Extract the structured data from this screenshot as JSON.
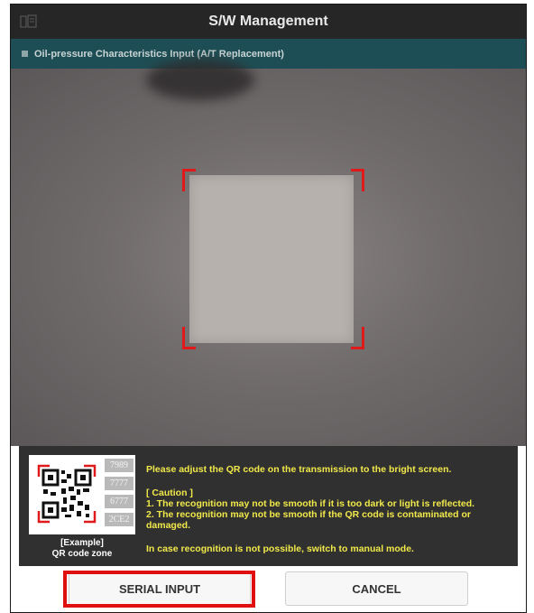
{
  "header": {
    "title": "S/W Management",
    "app_icon": "document-icon"
  },
  "subheader": {
    "title": "Oil-pressure Characteristics Input (A/T Replacement)"
  },
  "example": {
    "codes": [
      "7989",
      "7777",
      "6777",
      "2CE2"
    ],
    "caption_line1": "[Example]",
    "caption_line2": "QR code zone"
  },
  "messages": {
    "instruction": "Please adjust the QR code on the transmission to the bright screen.",
    "caution_title": "[ Caution ]",
    "caution_1": "1. The recognition may not be smooth if it is too dark or light is reflected.",
    "caution_2": "2. The recognition may not be smooth if the QR code is contaminated or damaged.",
    "fallback": "In case recognition is not possible, switch to manual mode."
  },
  "buttons": {
    "serial_input": "SERIAL INPUT",
    "cancel": "CANCEL"
  },
  "colors": {
    "accent_red": "#e01a1a",
    "header_bg": "#262626",
    "subheader_bg": "#1e4e55",
    "caution_text": "#f1e94a"
  }
}
